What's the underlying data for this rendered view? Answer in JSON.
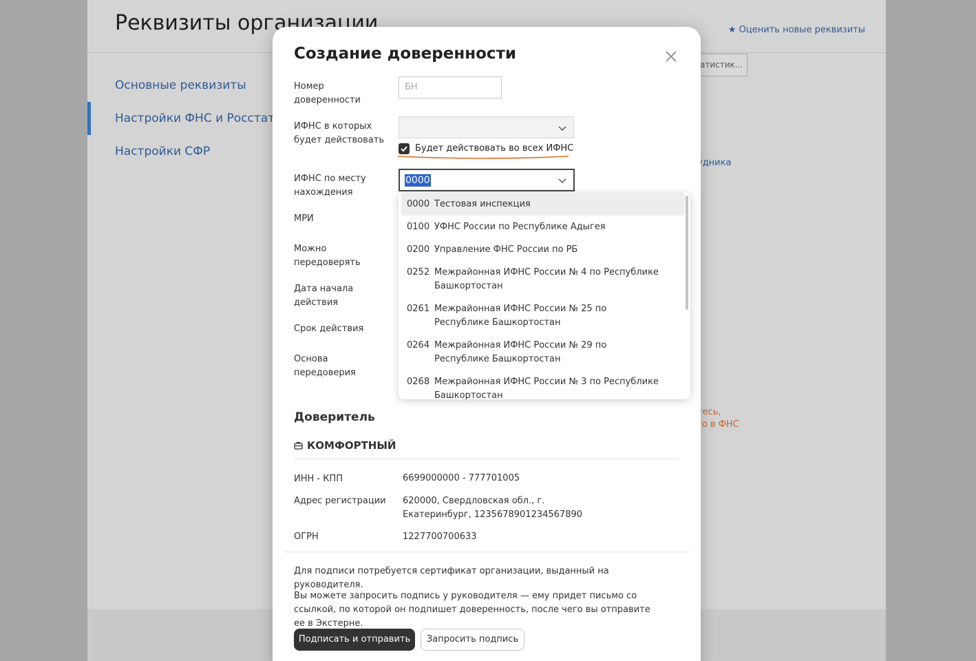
{
  "background": {
    "page_title": "Реквизиты организации",
    "rate_link": "Оценить новые реквизиты",
    "nav": [
      "Основные реквизиты",
      "Настройки ФНС и Росстат",
      "Настройки СФР"
    ],
    "stat_button": "атистик...",
    "side_link": "удника",
    "orange_line1": "тесь,",
    "orange_line2": "го в ФНС"
  },
  "modal": {
    "title": "Создание доверенности",
    "fields": {
      "number_label": "Номер доверенности",
      "number_placeholder": "БН",
      "ifns_label": "ИФНС в которых будет действовать",
      "ifns_value": "",
      "all_ifns_checkbox": "Будет действовать во всех ИФНС",
      "all_ifns_checked": true,
      "place_label": "ИФНС по месту нахождения",
      "place_value": "0000",
      "mri_label": "МРИ",
      "redelegate_label": "Можно передоверять",
      "start_label": "Дата начала действия",
      "term_label": "Срок действия",
      "basis_label": "Основа передоверия"
    },
    "principal": {
      "title": "Доверитель",
      "org_name": "КОМФОРТНЫЙ",
      "inn_kpp_label": "ИНН - КПП",
      "inn_kpp_value": "6699000000 - 777701005",
      "address_label": "Адрес регистрации",
      "address_value": "620000, Свердловская обл., г. Екатеринбург, 1235678901234567890",
      "ogrn_label": "ОГРН",
      "ogrn_value": "1227700700633"
    },
    "note1": "Для подписи потребуется сертификат организации, выданный на руководителя.",
    "note2": "Вы можете запросить подпись у руководителя — ему придет письмо со ссылкой, по которой он подпишет доверенность, после чего вы отправите ее в Экстерне.",
    "sign_button": "Подписать и отправить",
    "request_button": "Запросить подпись"
  },
  "dropdown": {
    "items": [
      {
        "code": "0000",
        "name": "Тестовая инспекция"
      },
      {
        "code": "0100",
        "name": "УФНС России по Республике Адыгея"
      },
      {
        "code": "0200",
        "name": "Управление ФНС России по РБ"
      },
      {
        "code": "0252",
        "name": "Межрайонная ИФНС России № 4 по Республике Башкортостан"
      },
      {
        "code": "0261",
        "name": "Межрайонная ИФНС России № 25 по Республике Башкортостан"
      },
      {
        "code": "0264",
        "name": "Межрайонная ИФНС России № 29 по Республике Башкортостан"
      },
      {
        "code": "0268",
        "name": "Межрайонная ИФНС России № 3 по Республике Башкортостан"
      }
    ]
  },
  "colors": {
    "link": "#2f5a94",
    "accent_bar": "#2d73c2",
    "highlight_underline": "#e2691f",
    "selection": "#2b63c9",
    "primary_button": "#333333"
  }
}
